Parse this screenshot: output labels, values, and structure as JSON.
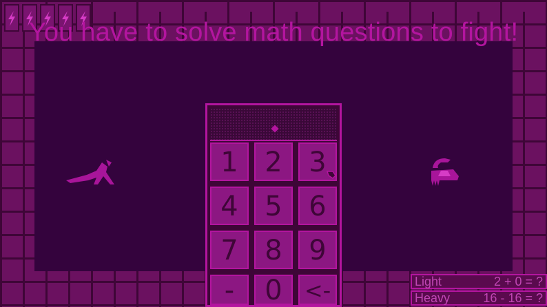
{
  "headline": "You have to solve math questions to fight!",
  "energy_cells": 5,
  "keypad": {
    "display_value": "",
    "keys": [
      {
        "label": "1"
      },
      {
        "label": "2"
      },
      {
        "label": "3"
      },
      {
        "label": "4"
      },
      {
        "label": "5"
      },
      {
        "label": "6"
      },
      {
        "label": "7"
      },
      {
        "label": "8"
      },
      {
        "label": "9"
      },
      {
        "label": "-"
      },
      {
        "label": "0"
      },
      {
        "label": "<-"
      }
    ]
  },
  "attacks": [
    {
      "name": "Light",
      "question": "2 + 0 = ?"
    },
    {
      "name": "Heavy",
      "question": "16 - 16 = ?"
    }
  ],
  "colors": {
    "accent": "#b3159f",
    "arena": "#34033d",
    "brick": "#6b1160"
  }
}
